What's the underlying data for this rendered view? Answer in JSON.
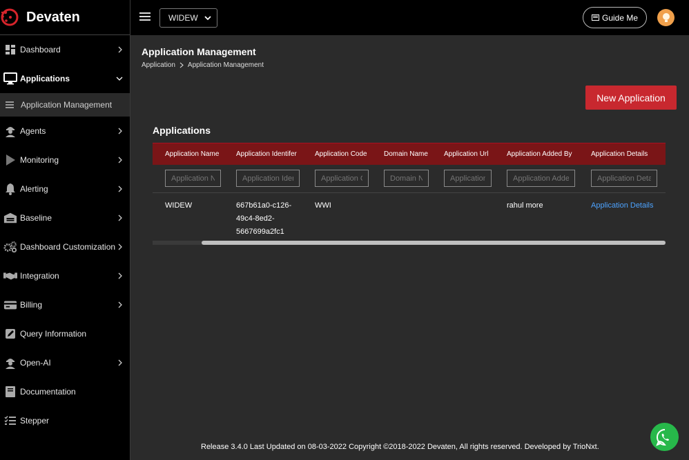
{
  "brand": {
    "name": "Devaten"
  },
  "topbar": {
    "org_selected": "WIDEW",
    "guide_label": "Guide Me"
  },
  "sidebar": {
    "items": [
      {
        "label": "Dashboard",
        "icon": "dashboard-icon"
      },
      {
        "label": "Applications",
        "icon": "monitor-icon"
      },
      {
        "label": "Agents",
        "icon": "agent-icon"
      },
      {
        "label": "Monitoring",
        "icon": "play-icon"
      },
      {
        "label": "Alerting",
        "icon": "bell-icon"
      },
      {
        "label": "Baseline",
        "icon": "warehouse-icon"
      },
      {
        "label": "Dashboard Customization",
        "icon": "gears-icon"
      },
      {
        "label": "Integration",
        "icon": "handshake-icon"
      },
      {
        "label": "Billing",
        "icon": "card-icon"
      },
      {
        "label": "Query Information",
        "icon": "edit-icon"
      },
      {
        "label": "Open-AI",
        "icon": "agent-icon"
      },
      {
        "label": "Documentation",
        "icon": "book-icon"
      },
      {
        "label": "Stepper",
        "icon": "list-icon"
      }
    ],
    "sub_items": [
      {
        "label": "Application Management"
      }
    ]
  },
  "main": {
    "title": "Application Management",
    "breadcrumb": [
      "Application",
      "Application Management"
    ],
    "new_button": "New Application",
    "section_title": "Applications",
    "table": {
      "columns": [
        "Application Name",
        "Application Identifer",
        "Application Code",
        "Domain Name",
        "Application Url",
        "Application Added By",
        "Application Details"
      ],
      "filters": [
        "Application Name",
        "Application Identifer",
        "Application Code",
        "Domain Name",
        "Application Url",
        "Application Added By",
        "Application Details"
      ],
      "rows": [
        {
          "name": "WIDEW",
          "identifier": [
            "667b61a0-c126-",
            "49c4-8ed2-",
            "5667699a2fc1"
          ],
          "code": "WWI",
          "domain": "",
          "url": "",
          "added_by": "rahul more",
          "details": "Application Details"
        }
      ]
    }
  },
  "footer": {
    "text": "Release 3.4.0 Last Updated on 08-03-2022 Copyright ©2018-2022 Devaten, All rights reserved. Developed by TrioNxt."
  }
}
